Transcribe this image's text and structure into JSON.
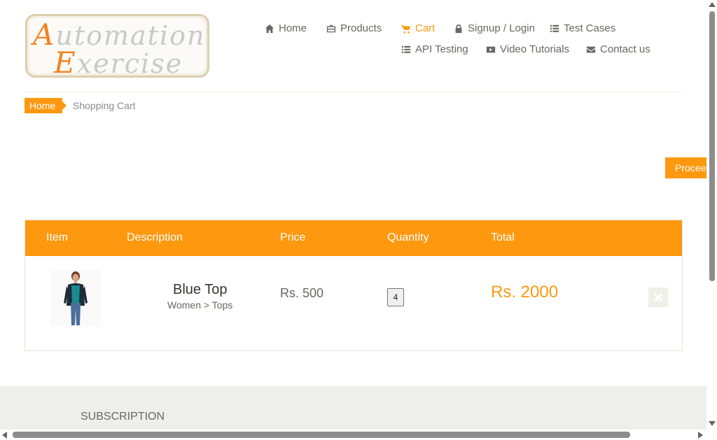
{
  "logo": {
    "line1_cap": "A",
    "line1_rest": "utomation",
    "line2_cap": "E",
    "line2_rest": "xercise"
  },
  "nav": {
    "home": "Home",
    "products": "Products",
    "cart": "Cart",
    "signup_login": "Signup / Login",
    "test_cases": "Test Cases",
    "api_testing": "API Testing",
    "video_tutorials": "Video Tutorials",
    "contact_us": "Contact us"
  },
  "breadcrumb": {
    "home": "Home",
    "current": "Shopping Cart"
  },
  "proceed_button": "Proceed To Checkout",
  "cart": {
    "headers": {
      "item": "Item",
      "description": "Description",
      "price": "Price",
      "quantity": "Quantity",
      "total": "Total"
    },
    "rows": [
      {
        "name": "Blue Top",
        "category": "Women > Tops",
        "price": "Rs. 500",
        "quantity": "4",
        "total": "Rs. 2000"
      }
    ]
  },
  "footer": {
    "subscription_title": "SUBSCRIPTION"
  },
  "colors": {
    "accent": "#fe980f",
    "text": "#696763",
    "footer_bg": "#eeeeea"
  }
}
